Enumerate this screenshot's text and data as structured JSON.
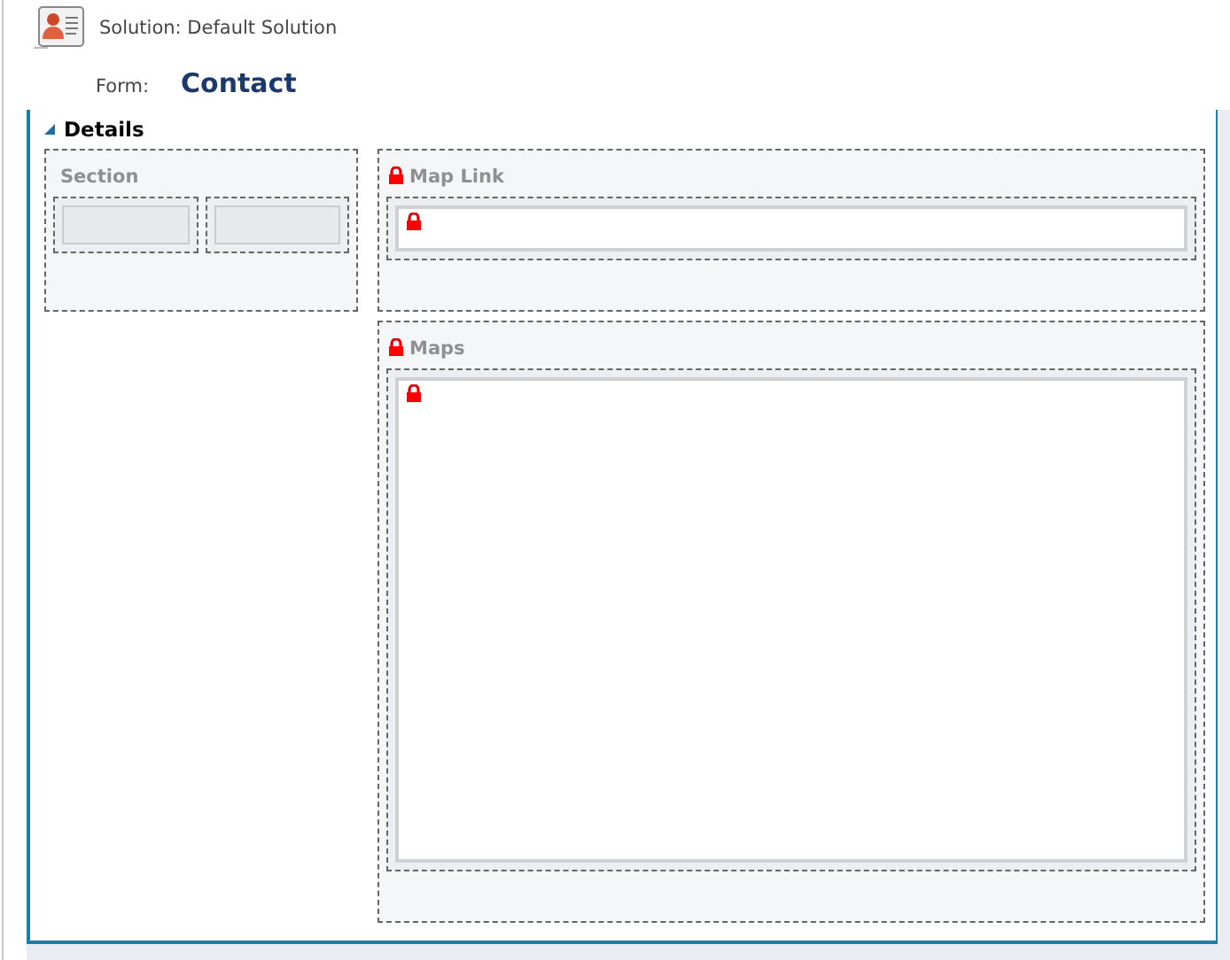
{
  "header": {
    "solution": "Solution: Default Solution",
    "form_label": "Form:",
    "form_name": "Contact"
  },
  "tab": {
    "title": "Details",
    "expanded": true,
    "columns": [
      {
        "sections": [
          {
            "title": "Section",
            "locked": false,
            "fields": [
              {
                "kind": "blank",
                "locked": false
              },
              {
                "kind": "blank",
                "locked": false
              }
            ]
          }
        ]
      },
      {
        "sections": [
          {
            "title": "Map Link",
            "locked": true,
            "fields": [
              {
                "kind": "text",
                "locked": true
              }
            ]
          },
          {
            "title": "Maps",
            "locked": true,
            "fields": [
              {
                "kind": "frame",
                "locked": true
              }
            ]
          }
        ]
      }
    ]
  }
}
